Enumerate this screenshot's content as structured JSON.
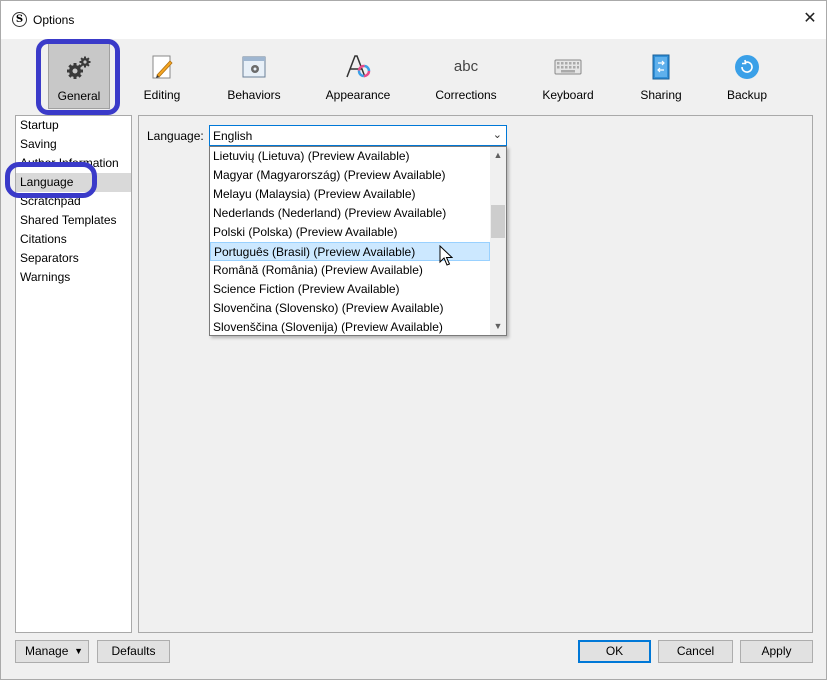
{
  "window": {
    "title": "Options",
    "app_icon_letter": "S",
    "close_glyph": "✕"
  },
  "toolbar": {
    "items": [
      {
        "label": "General",
        "icon": "gear-icon"
      },
      {
        "label": "Editing",
        "icon": "pencil-page-icon"
      },
      {
        "label": "Behaviors",
        "icon": "window-gear-icon"
      },
      {
        "label": "Appearance",
        "icon": "font-a-color-icon"
      },
      {
        "label": "Corrections",
        "icon": "abc-icon"
      },
      {
        "label": "Keyboard",
        "icon": "keyboard-icon"
      },
      {
        "label": "Sharing",
        "icon": "notebook-arrows-icon"
      },
      {
        "label": "Backup",
        "icon": "backup-circle-icon"
      }
    ],
    "selected": "General"
  },
  "sidebar": {
    "items": [
      {
        "label": "Startup"
      },
      {
        "label": "Saving"
      },
      {
        "label": "Author Information"
      },
      {
        "label": "Language"
      },
      {
        "label": "Scratchpad"
      },
      {
        "label": "Shared Templates"
      },
      {
        "label": "Citations"
      },
      {
        "label": "Separators"
      },
      {
        "label": "Warnings"
      }
    ],
    "selected": "Language"
  },
  "language": {
    "label": "Language:",
    "selected_value": "English",
    "options": [
      "Lietuvių (Lietuva) (Preview Available)",
      "Magyar (Magyarország) (Preview Available)",
      "Melayu (Malaysia) (Preview Available)",
      "Nederlands (Nederland) (Preview Available)",
      "Polski (Polska) (Preview Available)",
      "Português (Brasil) (Preview Available)",
      "Română (România) (Preview Available)",
      "Science Fiction (Preview Available)",
      "Slovenčina (Slovensko) (Preview Available)",
      "Slovenščina (Slovenija) (Preview Available)"
    ],
    "hovered_option": "Português (Brasil) (Preview Available)"
  },
  "footer": {
    "manage_label": "Manage",
    "defaults_label": "Defaults",
    "ok_label": "OK",
    "cancel_label": "Cancel",
    "apply_label": "Apply"
  },
  "colors": {
    "highlight_ring": "#3a3ac9",
    "accent": "#0078d7",
    "hover_bg": "#cce8ff",
    "backup_icon": "#3aa0e8"
  }
}
